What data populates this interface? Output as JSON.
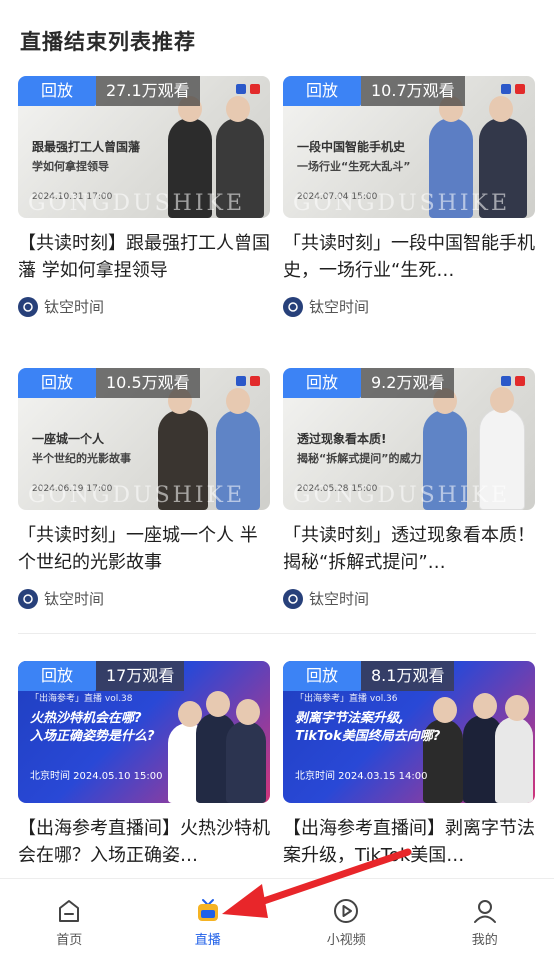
{
  "section_title": "直播结束列表推荐",
  "cards": [
    {
      "badge": "回放",
      "views": "27.1万观看",
      "poster_head": "跟最强打工人曾国藩",
      "poster_sub": "学如何拿捏领导",
      "poster_date": "2024.10.31  17:00",
      "watermark": "GONGDUSHIKE",
      "title": "【共读时刻】跟最强打工人曾国藩 学如何拿捏领导",
      "author": "钛空时间"
    },
    {
      "badge": "回放",
      "views": "10.7万观看",
      "poster_head": "一段中国智能手机史",
      "poster_sub": "一场行业“生死大乱斗”",
      "poster_date": "2024.07.04  15:00",
      "watermark": "GONGDUSHIKE",
      "title": "「共读时刻」一段中国智能手机史，一场行业“生死…",
      "author": "钛空时间"
    },
    {
      "badge": "回放",
      "views": "10.5万观看",
      "poster_head": "一座城一个人",
      "poster_sub": "半个世纪的光影故事",
      "poster_date": "2024.06.19  17:00",
      "watermark": "GONGDUSHIKE",
      "title": "「共读时刻」一座城一个人 半个世纪的光影故事",
      "author": "钛空时间"
    },
    {
      "badge": "回放",
      "views": "9.2万观看",
      "poster_head": "透过现象看本质!",
      "poster_sub": "揭秘“拆解式提问”的威力",
      "poster_date": "2024.05.28  15:00",
      "watermark": "GONGDUSHIKE",
      "title": "「共读时刻」透过现象看本质！揭秘“拆解式提问”…",
      "author": "钛空时间"
    },
    {
      "badge": "回放",
      "views": "17万观看",
      "poster_top": "「出海参考」直播 vol.38",
      "poster_head": "火热沙特机会在哪?",
      "poster_sub": "入场正确姿势是什么?",
      "poster_date": "北京时间 2024.05.10 15:00",
      "title": "【出海参考直播间】火热沙特机会在哪？入场正确姿…",
      "author": ""
    },
    {
      "badge": "回放",
      "views": "8.1万观看",
      "poster_top": "「出海参考」直播 vol.36",
      "poster_head": "剥离字节法案升级,",
      "poster_sub": "TikTok美国终局去向哪?",
      "poster_date": "北京时间 2024.03.15 14:00",
      "title": "【出海参考直播间】剥离字节法案升级，TikTok美国…",
      "author": ""
    }
  ],
  "tabbar": {
    "items": [
      {
        "label": "首页",
        "icon": "home-icon"
      },
      {
        "label": "直播",
        "icon": "tv-icon"
      },
      {
        "label": "小视频",
        "icon": "play-icon"
      },
      {
        "label": "我的",
        "icon": "user-icon"
      }
    ],
    "active": "直播"
  },
  "colors": {
    "accent": "#2060e8",
    "badge_blue": "#3c83f5",
    "annotation_arrow": "#e8262a"
  }
}
